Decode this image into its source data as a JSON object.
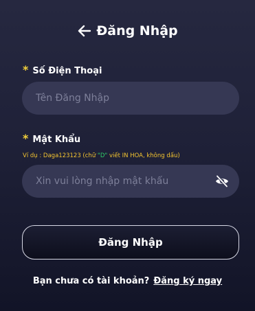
{
  "header": {
    "title": "Đăng Nhập",
    "back_icon": "arrow-left-icon"
  },
  "phone": {
    "required_mark": "*",
    "label": "Số Điện Thoại",
    "placeholder": "Tên Đăng Nhập",
    "value": ""
  },
  "password": {
    "required_mark": "*",
    "label": "Mật Khẩu",
    "hint_prefix": "Ví dụ : Daga123123 (chữ ",
    "hint_highlight": "\"D\"",
    "hint_suffix": " viết IN HOA, không dấu)",
    "placeholder": "Xin vui lòng nhập mật khẩu",
    "value": "",
    "toggle_icon": "eye-slash-icon"
  },
  "login_button": {
    "label": "Đăng Nhập"
  },
  "footer": {
    "prompt": "Bạn chưa có tài khoản?",
    "register_link": "Đăng ký ngay"
  },
  "colors": {
    "required_star": "#f4d23b",
    "hint_text": "#f4c430",
    "hint_highlight": "#2fd16a",
    "input_background": "#363854",
    "placeholder": "#7e809a"
  }
}
